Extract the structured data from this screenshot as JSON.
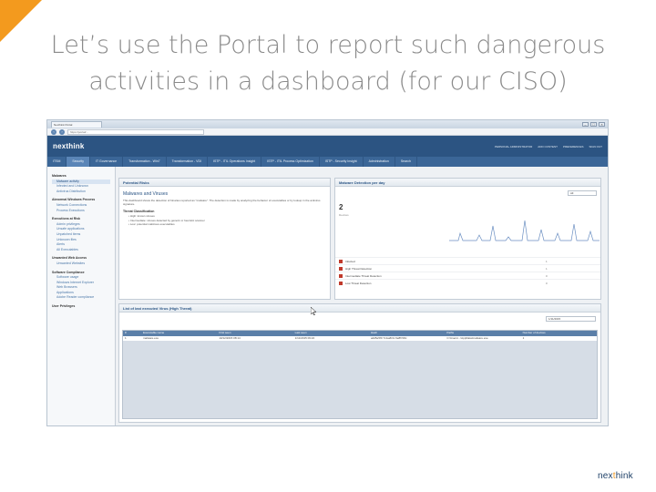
{
  "slide": {
    "title_line1": "Let’s use the Portal to report such dangerous",
    "title_line2": "activities in a dashboard (for our CISO)",
    "brand_prefix": "nex",
    "brand_accent": "t",
    "brand_suffix": "hink",
    "accent_color": "#f39a1e"
  },
  "browser": {
    "tab_label": "Nexthink Portal",
    "url": "https://portal/...",
    "controls": [
      "–",
      "□",
      "×"
    ]
  },
  "app": {
    "logo": "nexthink",
    "user_links": [
      "PERSONAL ADMINISTRATOR",
      "ADD CONTENT",
      "PREFERENCES",
      "SIGN OUT"
    ],
    "tabs": [
      {
        "label": "ITSM"
      },
      {
        "label": "Security"
      },
      {
        "label": "IT Governance"
      },
      {
        "label": "Transformation - Win7"
      },
      {
        "label": "Transformation - VDI"
      },
      {
        "label": "ISTP - ITIL Operations Insight"
      },
      {
        "label": "ISTP - ITIL Process Optimization"
      },
      {
        "label": "ISTP - Security Insight"
      },
      {
        "label": "Administration"
      },
      {
        "label": "Search"
      }
    ]
  },
  "sidebar": {
    "sections": [
      {
        "title": "Malwares",
        "items": [
          "Malware activity",
          "Infected and Unknown",
          "Antivirus Distribution"
        ]
      },
      {
        "title": "Abnormal Windows Process",
        "items": [
          "Network Connections",
          "Process Executions"
        ]
      },
      {
        "title": "Executions at Risk",
        "items": [
          "Admin privileges",
          "Unsafe applications",
          "Unpatched items",
          "Unknown files",
          "Alerts",
          "All Executables"
        ]
      },
      {
        "title": "Unwanted Web Access",
        "items": [
          "Unwanted Websites"
        ]
      },
      {
        "title": "Software Compliance",
        "items": [
          "Software usage",
          "Windows Internet Explorer",
          "Web Browsers",
          "Applications",
          "Adobe Reader compliance"
        ]
      },
      {
        "title": "User Privileges",
        "items": []
      }
    ]
  },
  "risk_panel": {
    "title": "Potential Risks",
    "heading": "Malwares and Viruses",
    "description": "This dashboard shows the detection of binaries reported as \"malware\". The detection is made by analyzing the behavior of executables or by lookup in the antivirus signature.",
    "subheading": "Threat Classification",
    "bullets": [
      "High: known viruses",
      "Intermediate: viruses detected by generic or heuristic scanner",
      "Low: potential malicious executables"
    ]
  },
  "detection_panel": {
    "title": "Malware Detection per day",
    "filter_value": "All",
    "metric_value": "2",
    "metric_label": "Devices",
    "legend": [
      {
        "label": "Infected",
        "value": "1"
      },
      {
        "label": "High Threat Detection",
        "value": "1"
      },
      {
        "label": "Intermediate Threat Detection",
        "value": "0"
      },
      {
        "label": "Low Threat Detection",
        "value": "0"
      }
    ]
  },
  "list_panel": {
    "title": "List of last executed Virus (High Threat)",
    "filter_value": "1/11/2015",
    "columns": [
      "#",
      "Executable name",
      "First seen",
      "Last seen",
      "Hash",
      "Paths",
      "Number of devices"
    ],
    "rows": [
      [
        "1",
        "malware.exe",
        "10/12/2015 08:14",
        "1/11/2015 09:22",
        "a4d5e5f0 7c1a2b3c 9e8f7d6c",
        "C:\\Users\\...\\AppData\\malware.exe",
        "1"
      ]
    ]
  }
}
